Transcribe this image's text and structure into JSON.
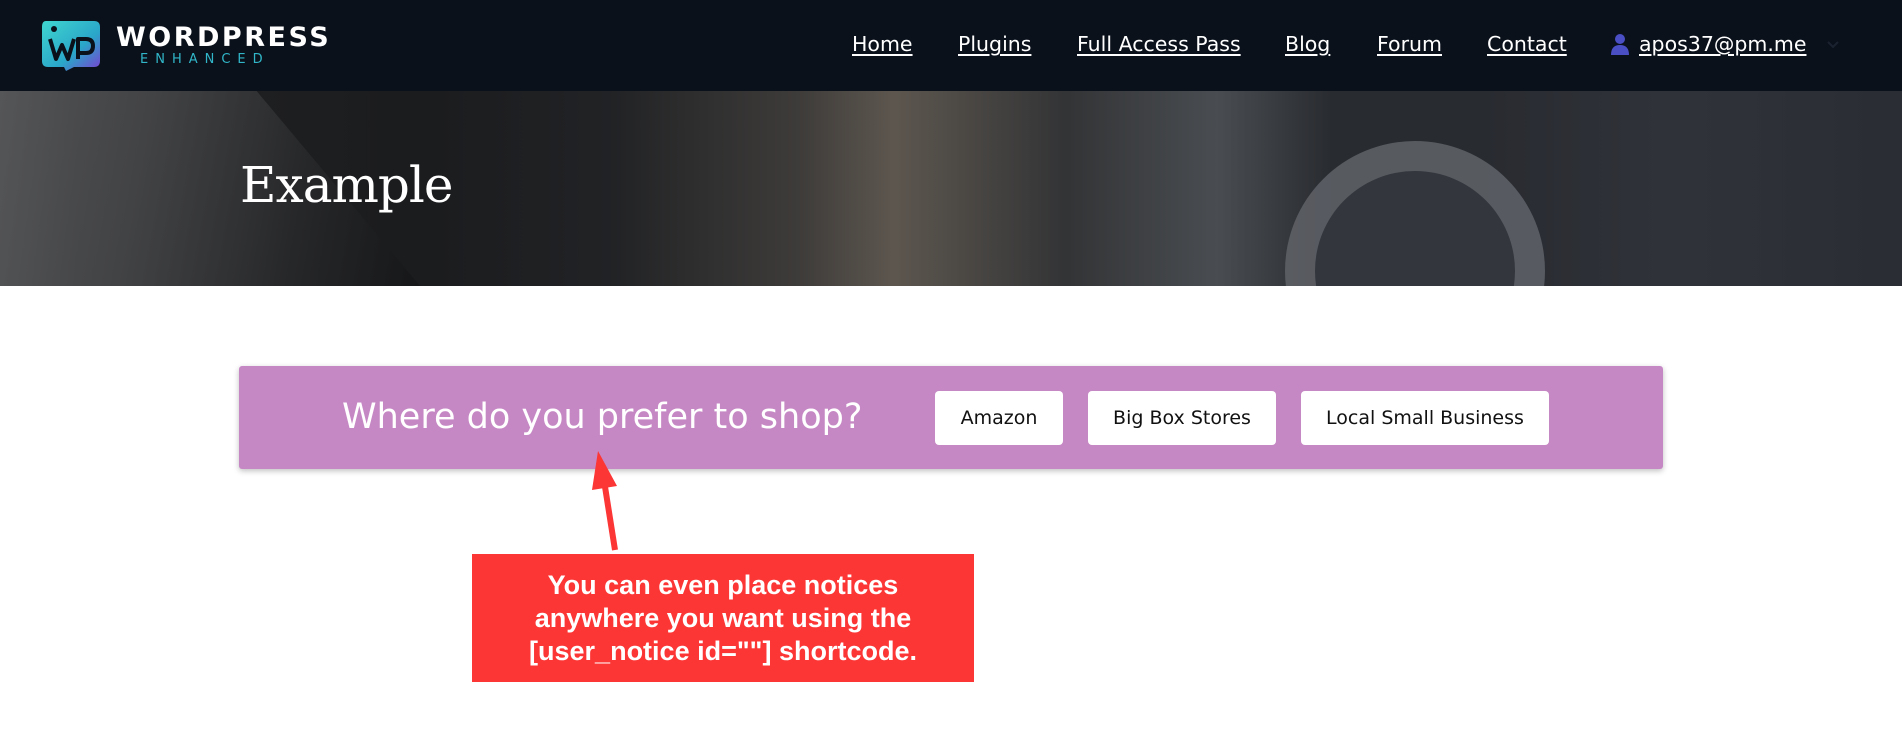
{
  "header": {
    "logo": {
      "mark_text": "WP",
      "name": "WORDPRESS",
      "tagline": "ENHANCED"
    },
    "nav": {
      "items": [
        {
          "label": "Home"
        },
        {
          "label": "Plugins"
        },
        {
          "label": "Full Access Pass"
        },
        {
          "label": "Blog"
        },
        {
          "label": "Forum"
        },
        {
          "label": "Contact"
        }
      ],
      "account": {
        "icon": "user-icon",
        "label": "apos37@pm.me",
        "dropdown_icon": "chevron-down-icon"
      }
    }
  },
  "hero": {
    "title": "Example"
  },
  "notice": {
    "question": "Where do you prefer to shop?",
    "options": [
      {
        "label": "Amazon"
      },
      {
        "label": "Big Box Stores"
      },
      {
        "label": "Local Small Business"
      }
    ]
  },
  "annotation": {
    "text": "You can even place notices anywhere you want using the [user_notice id=\"\"] shortcode."
  },
  "colors": {
    "header_bg": "#0b111b",
    "notice_bg": "#c688c4",
    "callout_bg": "#fc3535",
    "logo_accent": "#30b6c8",
    "user_icon": "#4a4fc4"
  }
}
